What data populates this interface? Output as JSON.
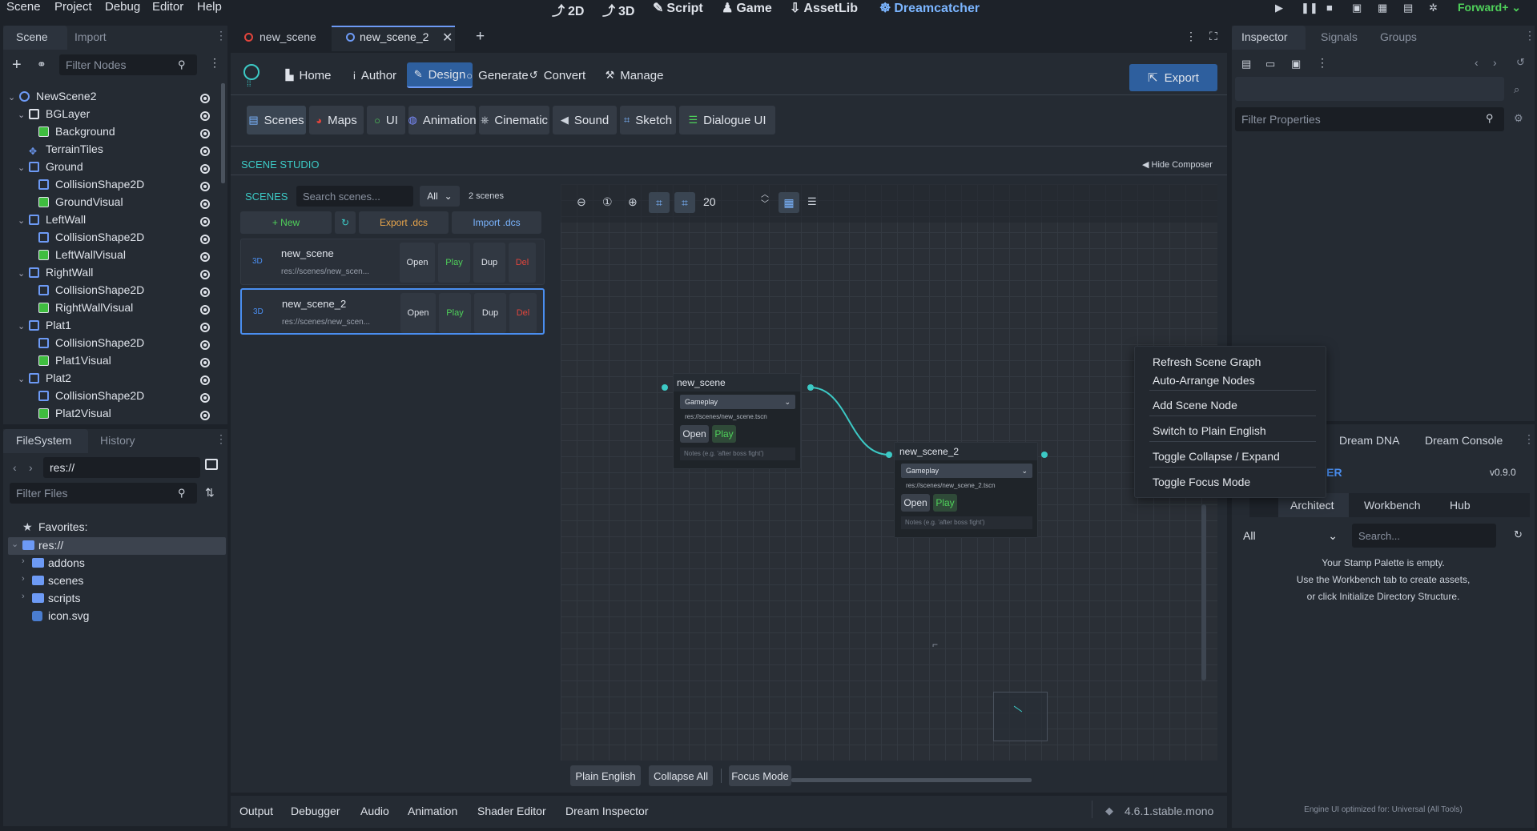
{
  "menubar": {
    "items": [
      "Scene",
      "Project",
      "Debug",
      "Editor",
      "Help"
    ],
    "workspaces": [
      {
        "icon": "2d-icon",
        "glyph": "⤴",
        "label": "2D"
      },
      {
        "icon": "3d-icon",
        "glyph": "⤴",
        "label": "3D"
      },
      {
        "icon": "script-icon",
        "glyph": "✎",
        "label": "Script"
      },
      {
        "icon": "game-icon",
        "glyph": "♟",
        "label": "Game"
      },
      {
        "icon": "assetlib-icon",
        "glyph": "⇩",
        "label": "AssetLib"
      },
      {
        "icon": "dreamcatcher-icon",
        "glyph": "☸",
        "label": "Dreamcatcher"
      }
    ],
    "renderer": "Forward+"
  },
  "scene_dock": {
    "tabs": [
      "Scene",
      "Import"
    ],
    "filter_placeholder": "Filter Nodes",
    "nodes": [
      {
        "label": "NewScene2",
        "depth": 0,
        "icon": "node",
        "arrow": "⌄"
      },
      {
        "label": "BGLayer",
        "depth": 1,
        "icon": "canvas",
        "arrow": "⌄"
      },
      {
        "label": "Background",
        "depth": 2,
        "icon": "green",
        "arrow": ""
      },
      {
        "label": "TerrainTiles",
        "depth": 1,
        "icon": "tiles",
        "arrow": ""
      },
      {
        "label": "Ground",
        "depth": 1,
        "icon": "body",
        "arrow": "⌄"
      },
      {
        "label": "CollisionShape2D",
        "depth": 2,
        "icon": "shape",
        "arrow": ""
      },
      {
        "label": "GroundVisual",
        "depth": 2,
        "icon": "green",
        "arrow": ""
      },
      {
        "label": "LeftWall",
        "depth": 1,
        "icon": "body",
        "arrow": "⌄"
      },
      {
        "label": "CollisionShape2D",
        "depth": 2,
        "icon": "shape",
        "arrow": ""
      },
      {
        "label": "LeftWallVisual",
        "depth": 2,
        "icon": "green",
        "arrow": ""
      },
      {
        "label": "RightWall",
        "depth": 1,
        "icon": "body",
        "arrow": "⌄"
      },
      {
        "label": "CollisionShape2D",
        "depth": 2,
        "icon": "shape",
        "arrow": ""
      },
      {
        "label": "RightWallVisual",
        "depth": 2,
        "icon": "green",
        "arrow": ""
      },
      {
        "label": "Plat1",
        "depth": 1,
        "icon": "body",
        "arrow": "⌄"
      },
      {
        "label": "CollisionShape2D",
        "depth": 2,
        "icon": "shape",
        "arrow": ""
      },
      {
        "label": "Plat1Visual",
        "depth": 2,
        "icon": "green",
        "arrow": ""
      },
      {
        "label": "Plat2",
        "depth": 1,
        "icon": "body",
        "arrow": "⌄"
      },
      {
        "label": "CollisionShape2D",
        "depth": 2,
        "icon": "shape",
        "arrow": ""
      },
      {
        "label": "Plat2Visual",
        "depth": 2,
        "icon": "green",
        "arrow": ""
      }
    ]
  },
  "filesystem": {
    "tabs": [
      "FileSystem",
      "History"
    ],
    "path": "res://",
    "filter_placeholder": "Filter Files",
    "favorites": "Favorites:",
    "root": "res://",
    "folders": [
      "addons",
      "scenes",
      "scripts"
    ],
    "file": "icon.svg"
  },
  "editor_tabs": {
    "tabs": [
      "new_scene",
      "new_scene_2"
    ]
  },
  "plugin_toolbar": {
    "items": [
      {
        "icon": "home-icon",
        "glyph": "▙",
        "label": "Home"
      },
      {
        "icon": "author-icon",
        "glyph": "i",
        "label": "Author"
      },
      {
        "icon": "design-icon",
        "glyph": "✎",
        "label": "Design"
      },
      {
        "icon": "generate-icon",
        "glyph": "○",
        "label": "Generate"
      },
      {
        "icon": "convert-icon",
        "glyph": "↺",
        "label": "Convert"
      },
      {
        "icon": "manage-icon",
        "glyph": "⚒",
        "label": "Manage"
      }
    ],
    "export_label": "Export",
    "subtabs": [
      {
        "icon": "scenes-icon",
        "glyph": "▤",
        "label": "Scenes"
      },
      {
        "icon": "maps-icon",
        "glyph": "◕",
        "label": "Maps"
      },
      {
        "icon": "ui-icon",
        "glyph": "○",
        "label": "UI"
      },
      {
        "icon": "animation-icon",
        "glyph": "◍",
        "label": "Animation"
      },
      {
        "icon": "cinematic-icon",
        "glyph": "⎈",
        "label": "Cinematic"
      },
      {
        "icon": "sound-icon",
        "glyph": "◀",
        "label": "Sound"
      },
      {
        "icon": "sketch-icon",
        "glyph": "⌗",
        "label": "Sketch"
      },
      {
        "icon": "dialogue-icon",
        "glyph": "☰",
        "label": "Dialogue UI"
      }
    ]
  },
  "scene_studio": {
    "title": "SCENE STUDIO",
    "hide_composer": "◀ Hide Composer",
    "scenes_label": "SCENES",
    "search_placeholder": "Search scenes...",
    "filter": "All",
    "count": "2 scenes",
    "new_label": "+ New",
    "refresh_glyph": "↻",
    "export_label": "Export .dcs",
    "import_label": "Import .dcs",
    "list": [
      {
        "badge": "3D",
        "name": "new_scene",
        "path": "res://scenes/new_scen...",
        "open": "Open",
        "play": "Play",
        "dup": "Dup",
        "del": "Del"
      },
      {
        "badge": "3D",
        "name": "new_scene_2",
        "path": "res://scenes/new_scen...",
        "open": "Open",
        "play": "Play",
        "dup": "Dup",
        "del": "Del"
      }
    ]
  },
  "graph": {
    "zoom_value": "20",
    "nodes": [
      {
        "title": "new_scene",
        "category": "Gameplay",
        "path": "res://scenes/new_scene.tscn",
        "open": "Open",
        "play": "Play",
        "notes": "Notes (e.g. 'after boss fight')"
      },
      {
        "title": "new_scene_2",
        "category": "Gameplay",
        "path": "res://scenes/new_scene_2.tscn",
        "open": "Open",
        "play": "Play",
        "notes": "Notes (e.g. 'after boss fight')"
      }
    ],
    "bottom_buttons": [
      "Plain English",
      "Collapse All",
      "Focus Mode"
    ]
  },
  "context_menu": {
    "items": [
      "Refresh Scene Graph",
      "Auto-Arrange Nodes",
      "Add Scene Node",
      "Switch to Plain English",
      "Toggle Collapse / Expand",
      "Toggle Focus Mode"
    ]
  },
  "bottom_panel": {
    "tabs": [
      "Output",
      "Debugger",
      "Audio",
      "Animation",
      "Shader Editor",
      "Dream Inspector"
    ],
    "version": "4.6.1.stable.mono"
  },
  "inspector": {
    "tabs": [
      "Inspector",
      "Signals",
      "Groups"
    ],
    "filter_placeholder": "Filter Properties"
  },
  "dream_dock": {
    "tabs": [
      "Dream DNA",
      "Dream Console"
    ],
    "title_partial": "HER",
    "version": "v0.9.0",
    "subtabs": [
      "Architect",
      "Workbench",
      "Hub"
    ],
    "filter": "All",
    "search_placeholder": "Search...",
    "empty_lines": [
      "Your Stamp Palette is empty.",
      "Use the Workbench tab to create assets,",
      "or click Initialize Directory Structure."
    ],
    "footer": "Engine UI optimized for: Universal (All Tools)"
  },
  "colors": {
    "accent": "#3cc9c5",
    "active": "#2e5f9e",
    "play": "#4fd15a",
    "del": "#e2453c",
    "export": "#e8a54b"
  }
}
